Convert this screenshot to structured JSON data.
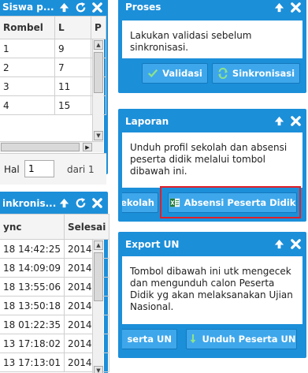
{
  "siswa_panel": {
    "title": "Siswa p...",
    "columns": [
      "Rombel",
      "L",
      "P"
    ],
    "rows": [
      {
        "rombel": "1",
        "l": "9"
      },
      {
        "rombel": "2",
        "l": "7"
      },
      {
        "rombel": "3",
        "l": "11"
      },
      {
        "rombel": "4",
        "l": "15"
      }
    ],
    "pager": {
      "label": "Hal",
      "page_value": "1",
      "total_text": "dari 1"
    }
  },
  "sinkronisasi_panel": {
    "title": "inkronis...",
    "columns": [
      "ync",
      "Selesai"
    ],
    "rows": [
      {
        "sync": "18 14:42:25",
        "selesai": "2014-"
      },
      {
        "sync": "18 14:09:09",
        "selesai": "2014-"
      },
      {
        "sync": "18 13:55:06",
        "selesai": "2014-"
      },
      {
        "sync": "18 13:50:18",
        "selesai": "2014-"
      },
      {
        "sync": "18 01:22:35",
        "selesai": "2014-"
      },
      {
        "sync": "13 17:18:02",
        "selesai": "2014-"
      },
      {
        "sync": "13 17:13:01",
        "selesai": "2014-"
      }
    ]
  },
  "proses_panel": {
    "title": "Proses",
    "text": "Lakukan validasi sebelum sinkronisasi.",
    "buttons": {
      "validasi": "Validasi",
      "sinkronisasi": "Sinkronisasi"
    }
  },
  "laporan_panel": {
    "title": "Laporan",
    "text": "Unduh profil sekolah dan absensi peserta didik melalui tombol dibawah ini.",
    "buttons": {
      "profil_sekolah": "ekolah",
      "absensi": "Absensi Peserta Didik"
    }
  },
  "export_panel": {
    "title": "Export UN",
    "text": "Tombol dibawah ini utk mengecek dan mengunduh calon Peserta Didik yg akan melaksanakan Ujian Nasional.",
    "buttons": {
      "cek_peserta": "serta UN",
      "unduh_peserta": "Unduh Peserta UN"
    }
  },
  "icons": {
    "collapse": "arrow-up-icon",
    "refresh": "refresh-icon",
    "close": "close-icon",
    "validasi": "check-icon",
    "sinkronisasi": "sync-icon",
    "absensi": "excel-icon",
    "unduh": "download-arrow-icon"
  },
  "colors": {
    "panel_blue": "#1c8fd9",
    "button_blue": "#3ea7eb",
    "highlight_red": "#e0202a"
  }
}
